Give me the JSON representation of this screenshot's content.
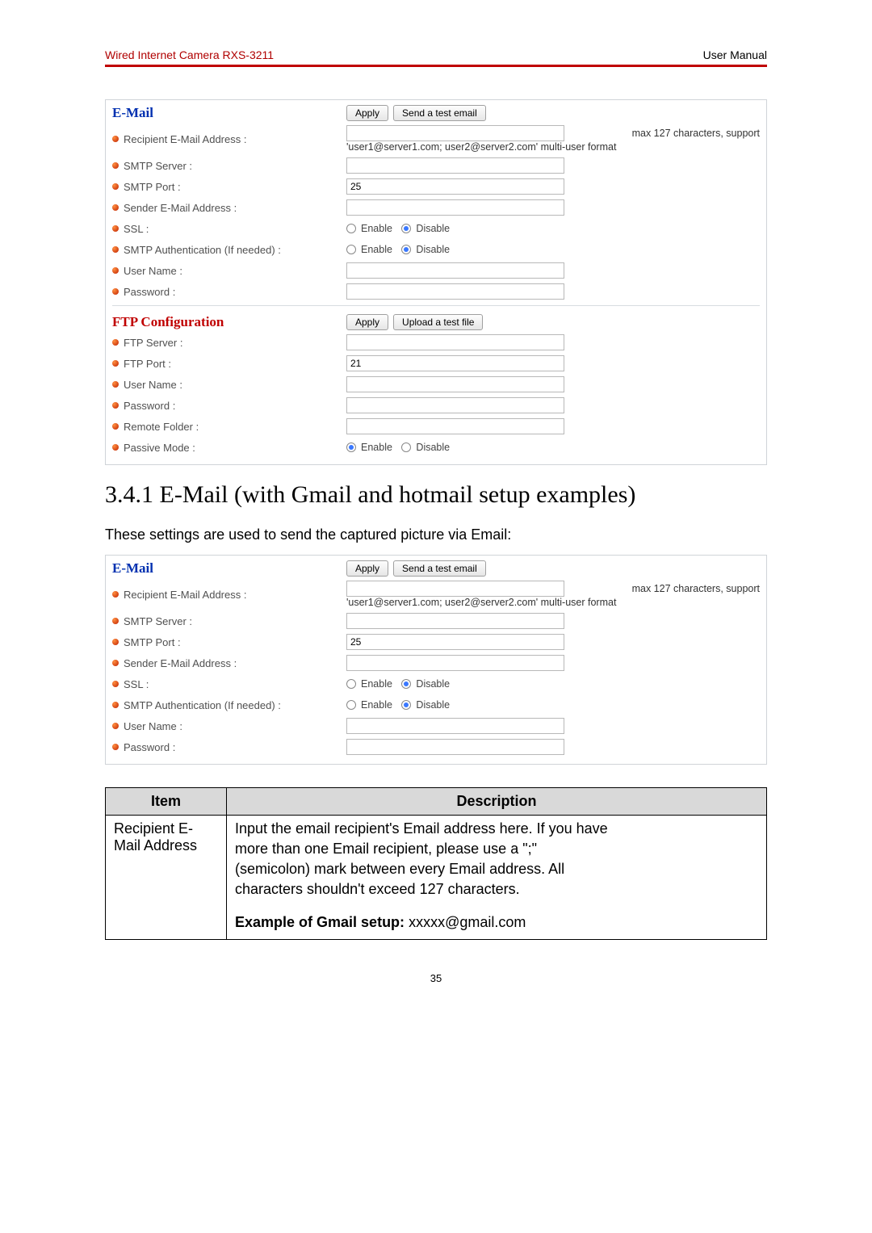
{
  "header": {
    "product": "Wired Internet Camera RXS-3211",
    "doc_type": "User Manual"
  },
  "email_section": {
    "title": "E-Mail",
    "apply_btn": "Apply",
    "test_btn": "Send a test email",
    "rows": {
      "recipient_label": "Recipient E-Mail Address :",
      "recipient_hint_top": "max 127 characters, support",
      "recipient_hint_bottom": "'user1@server1.com; user2@server2.com' multi-user format",
      "smtp_server_label": "SMTP Server :",
      "smtp_server_value": "",
      "smtp_port_label": "SMTP Port :",
      "smtp_port_value": "25",
      "sender_label": "Sender E-Mail Address :",
      "sender_value": "",
      "ssl_label": "SSL :",
      "auth_label": "SMTP Authentication (If needed) :",
      "user_label": "User Name :",
      "user_value": "",
      "pass_label": "Password :",
      "pass_value": "",
      "opt_enable": "Enable",
      "opt_disable": "Disable"
    }
  },
  "ftp_section": {
    "title": "FTP Configuration",
    "apply_btn": "Apply",
    "test_btn": "Upload a test file",
    "rows": {
      "server_label": "FTP Server :",
      "server_value": "",
      "port_label": "FTP Port :",
      "port_value": "21",
      "user_label": "User Name :",
      "user_value": "",
      "pass_label": "Password :",
      "pass_value": "",
      "folder_label": "Remote Folder :",
      "folder_value": "",
      "passive_label": "Passive Mode :",
      "opt_enable": "Enable",
      "opt_disable": "Disable"
    }
  },
  "section_heading": "3.4.1 E-Mail (with Gmail and hotmail setup examples)",
  "intro_text": "These settings are used to send the captured picture via Email:",
  "table": {
    "head_item": "Item",
    "head_desc": "Description",
    "row1_item": "Recipient E-Mail Address",
    "row1_desc_l1": "Input the email recipient's Email address here. If you have",
    "row1_desc_l2": "more than one Email recipient, please use a \";\"",
    "row1_desc_l3": "(semicolon) mark between every Email address. All",
    "row1_desc_l4": "characters shouldn't exceed 127 characters.",
    "row1_desc_ex_bold": "Example of Gmail setup: ",
    "row1_desc_ex_rest": "xxxxx@gmail.com"
  },
  "page_number": "35"
}
